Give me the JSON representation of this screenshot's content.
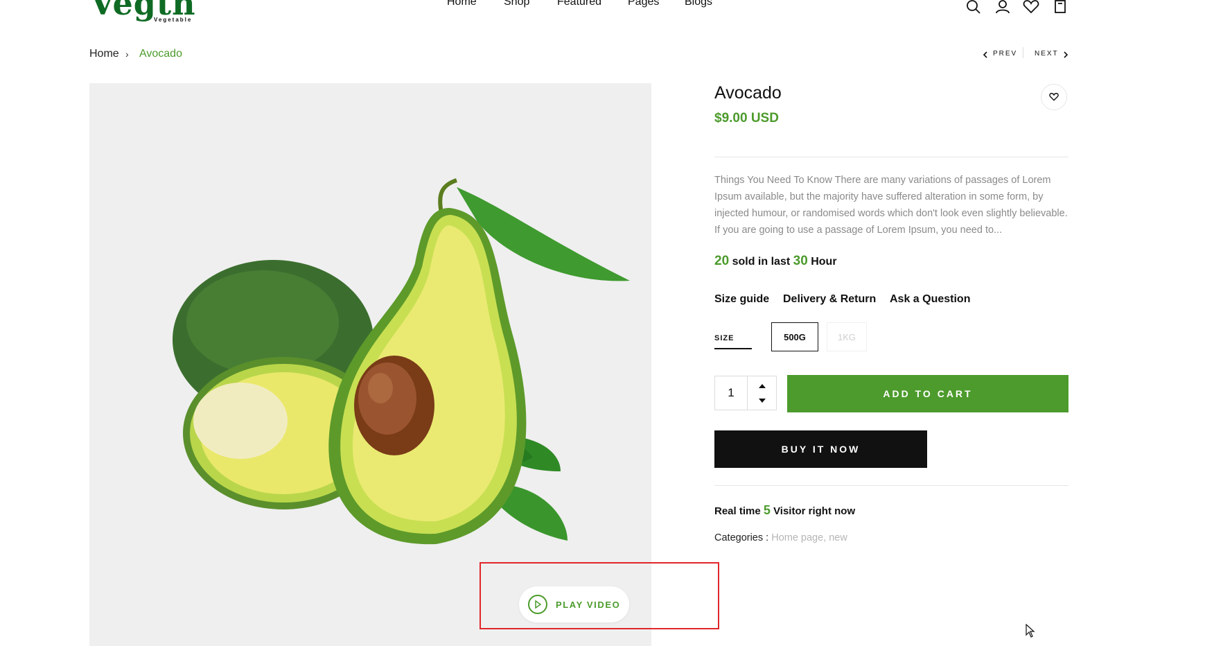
{
  "header": {
    "logo_text": "Vegtn",
    "logo_sub": "Vegetable",
    "nav": [
      "Home",
      "Shop",
      "Featured",
      "Pages",
      "Blogs"
    ],
    "icons": [
      "search-icon",
      "user-icon",
      "heart-icon",
      "cart-icon"
    ]
  },
  "breadcrumb": {
    "home": "Home",
    "sep": "›",
    "current": "Avocado"
  },
  "pager": {
    "prev": "PREV",
    "next": "NEXT"
  },
  "gallery": {
    "play_label": "PLAY VIDEO"
  },
  "product": {
    "title": "Avocado",
    "price": "$9.00 USD",
    "description": "Things You Need To Know There are many variations of passages of Lorem Ipsum available, but the majority have suffered alteration in some form, by injected humour, or randomised words which don't look even slightly believable. If you are going to use a passage of Lorem Ipsum, you need to...",
    "sold": {
      "count": "20",
      "text_mid": "sold in last",
      "hours": "30",
      "text_end": "Hour"
    },
    "links": [
      "Size guide",
      "Delivery & Return",
      "Ask a Question"
    ],
    "size_label": "SIZE",
    "sizes": [
      "500G",
      "1KG"
    ],
    "selected_size": "500G",
    "quantity": "1",
    "add_to_cart": "ADD TO CART",
    "buy_now": "BUY IT NOW",
    "visitors": {
      "prefix": "Real time",
      "count": "5",
      "suffix": "Visitor right now"
    },
    "categories_label": "Categories :",
    "categories_value": "Home page, new"
  },
  "colors": {
    "accent_green": "#4c9b2c",
    "logo_green": "#0f6b24",
    "highlight_red": "#e0262a",
    "black_button": "#111111"
  }
}
